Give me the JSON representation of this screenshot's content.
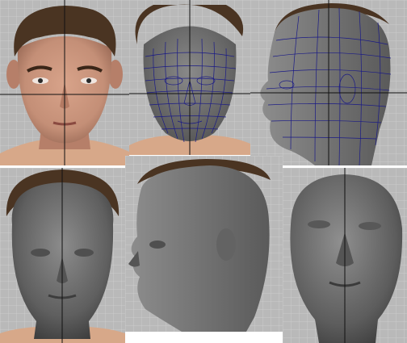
{
  "window": {
    "title": ""
  },
  "viewports": [
    {
      "id": "vp-front-photo",
      "name": "front-photo",
      "shading": "photo",
      "view": "front"
    },
    {
      "id": "vp-front-wire",
      "name": "front-wireframe",
      "shading": "wireframe",
      "view": "front"
    },
    {
      "id": "vp-side-wire",
      "name": "side-wireframe",
      "shading": "wireframe",
      "view": "side"
    },
    {
      "id": "vp-front-smooth",
      "name": "front-smooth",
      "shading": "smooth",
      "view": "front"
    },
    {
      "id": "vp-side-smooth",
      "name": "side-smooth",
      "shading": "smooth",
      "view": "side"
    },
    {
      "id": "vp-persp-smooth",
      "name": "perspective-smooth",
      "shading": "smooth",
      "view": "perspective"
    }
  ],
  "colors": {
    "viewport_background": "#b9b9b9",
    "grid_line": "#d8d8d8",
    "grid_axis": "#111111",
    "hair": "#4a3422",
    "skin": "#c48f77",
    "shirt": "#d7a889",
    "mesh_gray": "#6e6e6e",
    "mesh_dark": "#3d3d3d",
    "wire_blue": "#1a1a86"
  }
}
